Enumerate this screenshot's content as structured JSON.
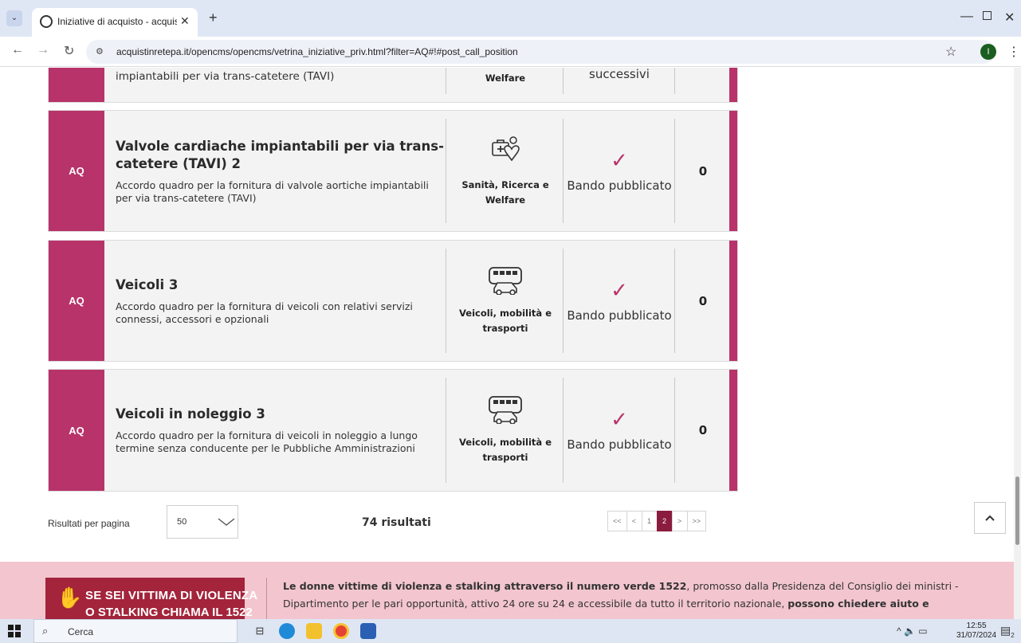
{
  "browser": {
    "tab_title": "Iniziative di acquisto - acquistin",
    "url": "acquistinretepa.it/opencms/opencms/vetrina_iniziative_priv.html?filter=AQ#!#post_call_position"
  },
  "top_partial": {
    "desc_line": "impiantabili per via trans-catetere (TAVI)",
    "category": "Welfare",
    "status": "successivi"
  },
  "cards": [
    {
      "tag": "AQ",
      "title": "Valvole cardiache impiantabili per via trans-catetere (TAVI) 2",
      "desc": "Accordo quadro per la fornitura di valvole aortiche impiantabili per via trans-catetere (TAVI)",
      "category_icon": "healthcare-icon",
      "category": "Sanità, Ricerca e Welfare",
      "status": "Bando pubblicato",
      "count": "0"
    },
    {
      "tag": "AQ",
      "title": "Veicoli 3",
      "desc": "Accordo quadro per la fornitura di veicoli con relativi servizi connessi, accessori e opzionali",
      "category_icon": "vehicles-icon",
      "category": "Veicoli, mobilità e trasporti",
      "status": "Bando pubblicato",
      "count": "0"
    },
    {
      "tag": "AQ",
      "title": "Veicoli in noleggio 3",
      "desc": "Accordo quadro per la fornitura di veicoli in noleggio a lungo termine senza conducente per le Pubbliche Amministrazioni",
      "category_icon": "vehicles-icon",
      "category": "Veicoli, mobilità e trasporti",
      "status": "Bando pubblicato",
      "count": "0"
    }
  ],
  "pagination": {
    "per_page_label": "Risultati per pagina",
    "per_page_value": "50",
    "results": "74 risultati",
    "pages": [
      "<<",
      "<",
      "1",
      "2",
      ">",
      ">>"
    ],
    "active_page": "2"
  },
  "banner": {
    "logo_line1": "SE SEI VITTIMA DI VIOLENZA",
    "logo_line2": "O STALKING CHIAMA IL 1522",
    "text_bold1": "Le donne vittime di violenza e stalking attraverso il numero verde 1522",
    "text_normal": ", promosso dalla Presidenza del Consiglio dei ministri - Dipartimento per le pari opportunità, attivo 24 ore su 24 e accessibile da tutto il territorio nazionale, ",
    "text_bold2": "possono chiedere aiuto e"
  },
  "taskbar": {
    "search_placeholder": "Cerca",
    "time": "12:55",
    "date": "31/07/2024",
    "notifications": "2"
  },
  "colors": {
    "accent": "#b8336a",
    "active_page": "#8a1c3f",
    "banner_bg": "#f3c6cf"
  }
}
